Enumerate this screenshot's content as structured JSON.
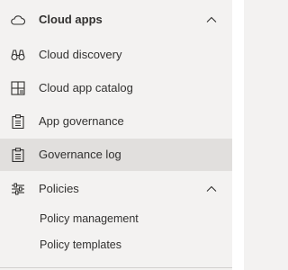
{
  "nav": {
    "groups": [
      {
        "label": "Cloud apps",
        "icon": "cloud-icon",
        "expanded": true,
        "items": [
          {
            "label": "Cloud discovery",
            "icon": "binoculars-icon"
          },
          {
            "label": "Cloud app catalog",
            "icon": "catalog-icon"
          },
          {
            "label": "App governance",
            "icon": "clipboard-icon"
          },
          {
            "label": "Governance log",
            "icon": "clipboard-icon",
            "selected": true
          }
        ]
      },
      {
        "label": "Policies",
        "icon": "sliders-icon",
        "expanded": true,
        "items": [
          {
            "label": "Policy management"
          },
          {
            "label": "Policy templates"
          }
        ]
      }
    ]
  },
  "colors": {
    "background": "#f3f2f1",
    "selected": "#e1dfdd",
    "text": "#323130"
  }
}
